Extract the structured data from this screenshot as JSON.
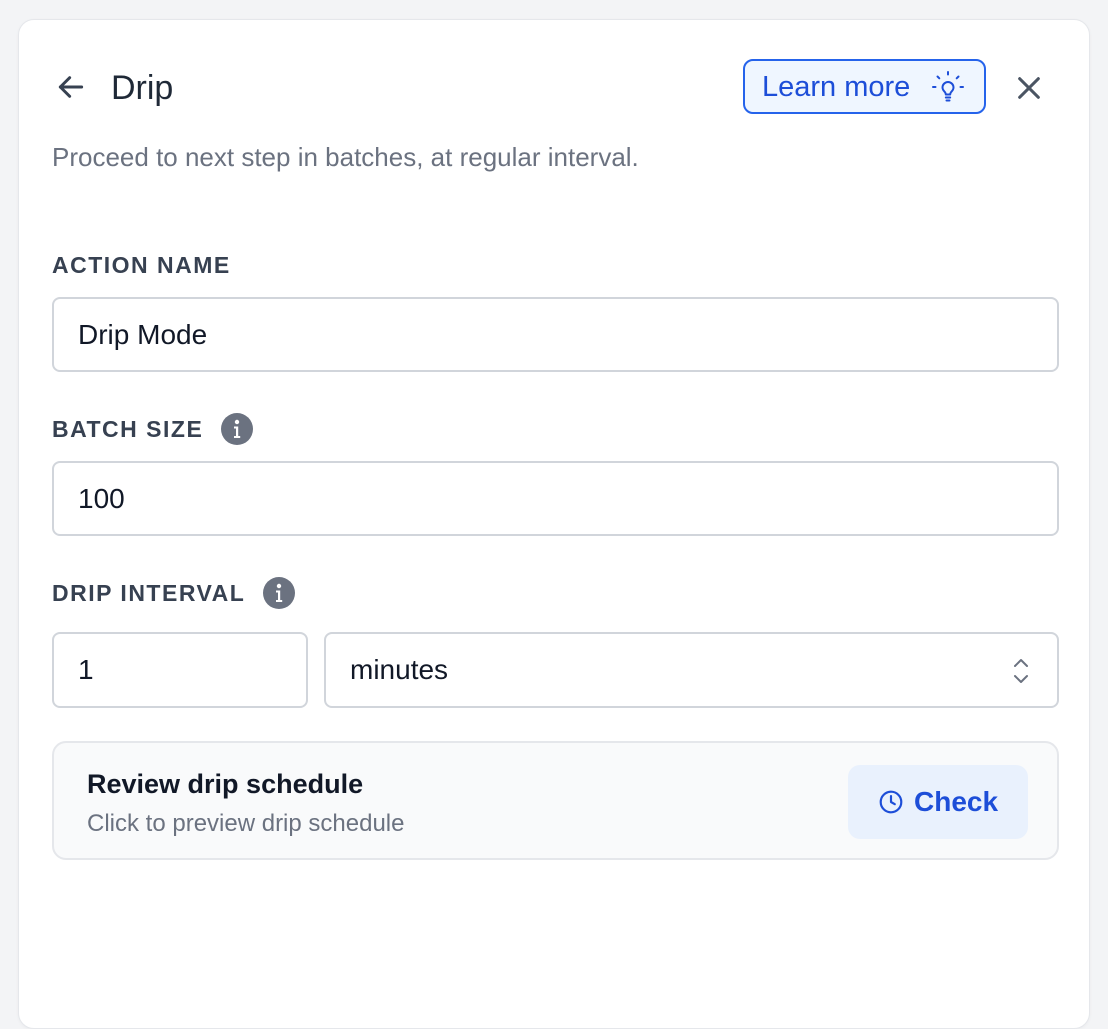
{
  "header": {
    "title": "Drip",
    "learn_more_label": "Learn more",
    "description": "Proceed to next step in batches, at regular interval."
  },
  "fields": {
    "action_name": {
      "label": "ACTION NAME",
      "value": "Drip Mode"
    },
    "batch_size": {
      "label": "BATCH SIZE",
      "value": "100"
    },
    "drip_interval": {
      "label": "DRIP INTERVAL",
      "value": "1",
      "unit": "minutes"
    }
  },
  "review": {
    "title": "Review drip schedule",
    "subtitle": "Click to preview drip schedule",
    "check_label": "Check"
  },
  "icons": {
    "back": "arrow-left-icon",
    "learn_more": "lightbulb-icon",
    "close": "close-icon",
    "info": "info-icon",
    "select": "chevron-up-down-icon",
    "check": "clock-icon"
  },
  "colors": {
    "accent": "#1d4ed8",
    "accent_border": "#2563eb",
    "accent_bg": "#eff6ff",
    "text_primary": "#1f2937",
    "text_muted": "#6b7280",
    "info_icon": "#6b7280"
  }
}
